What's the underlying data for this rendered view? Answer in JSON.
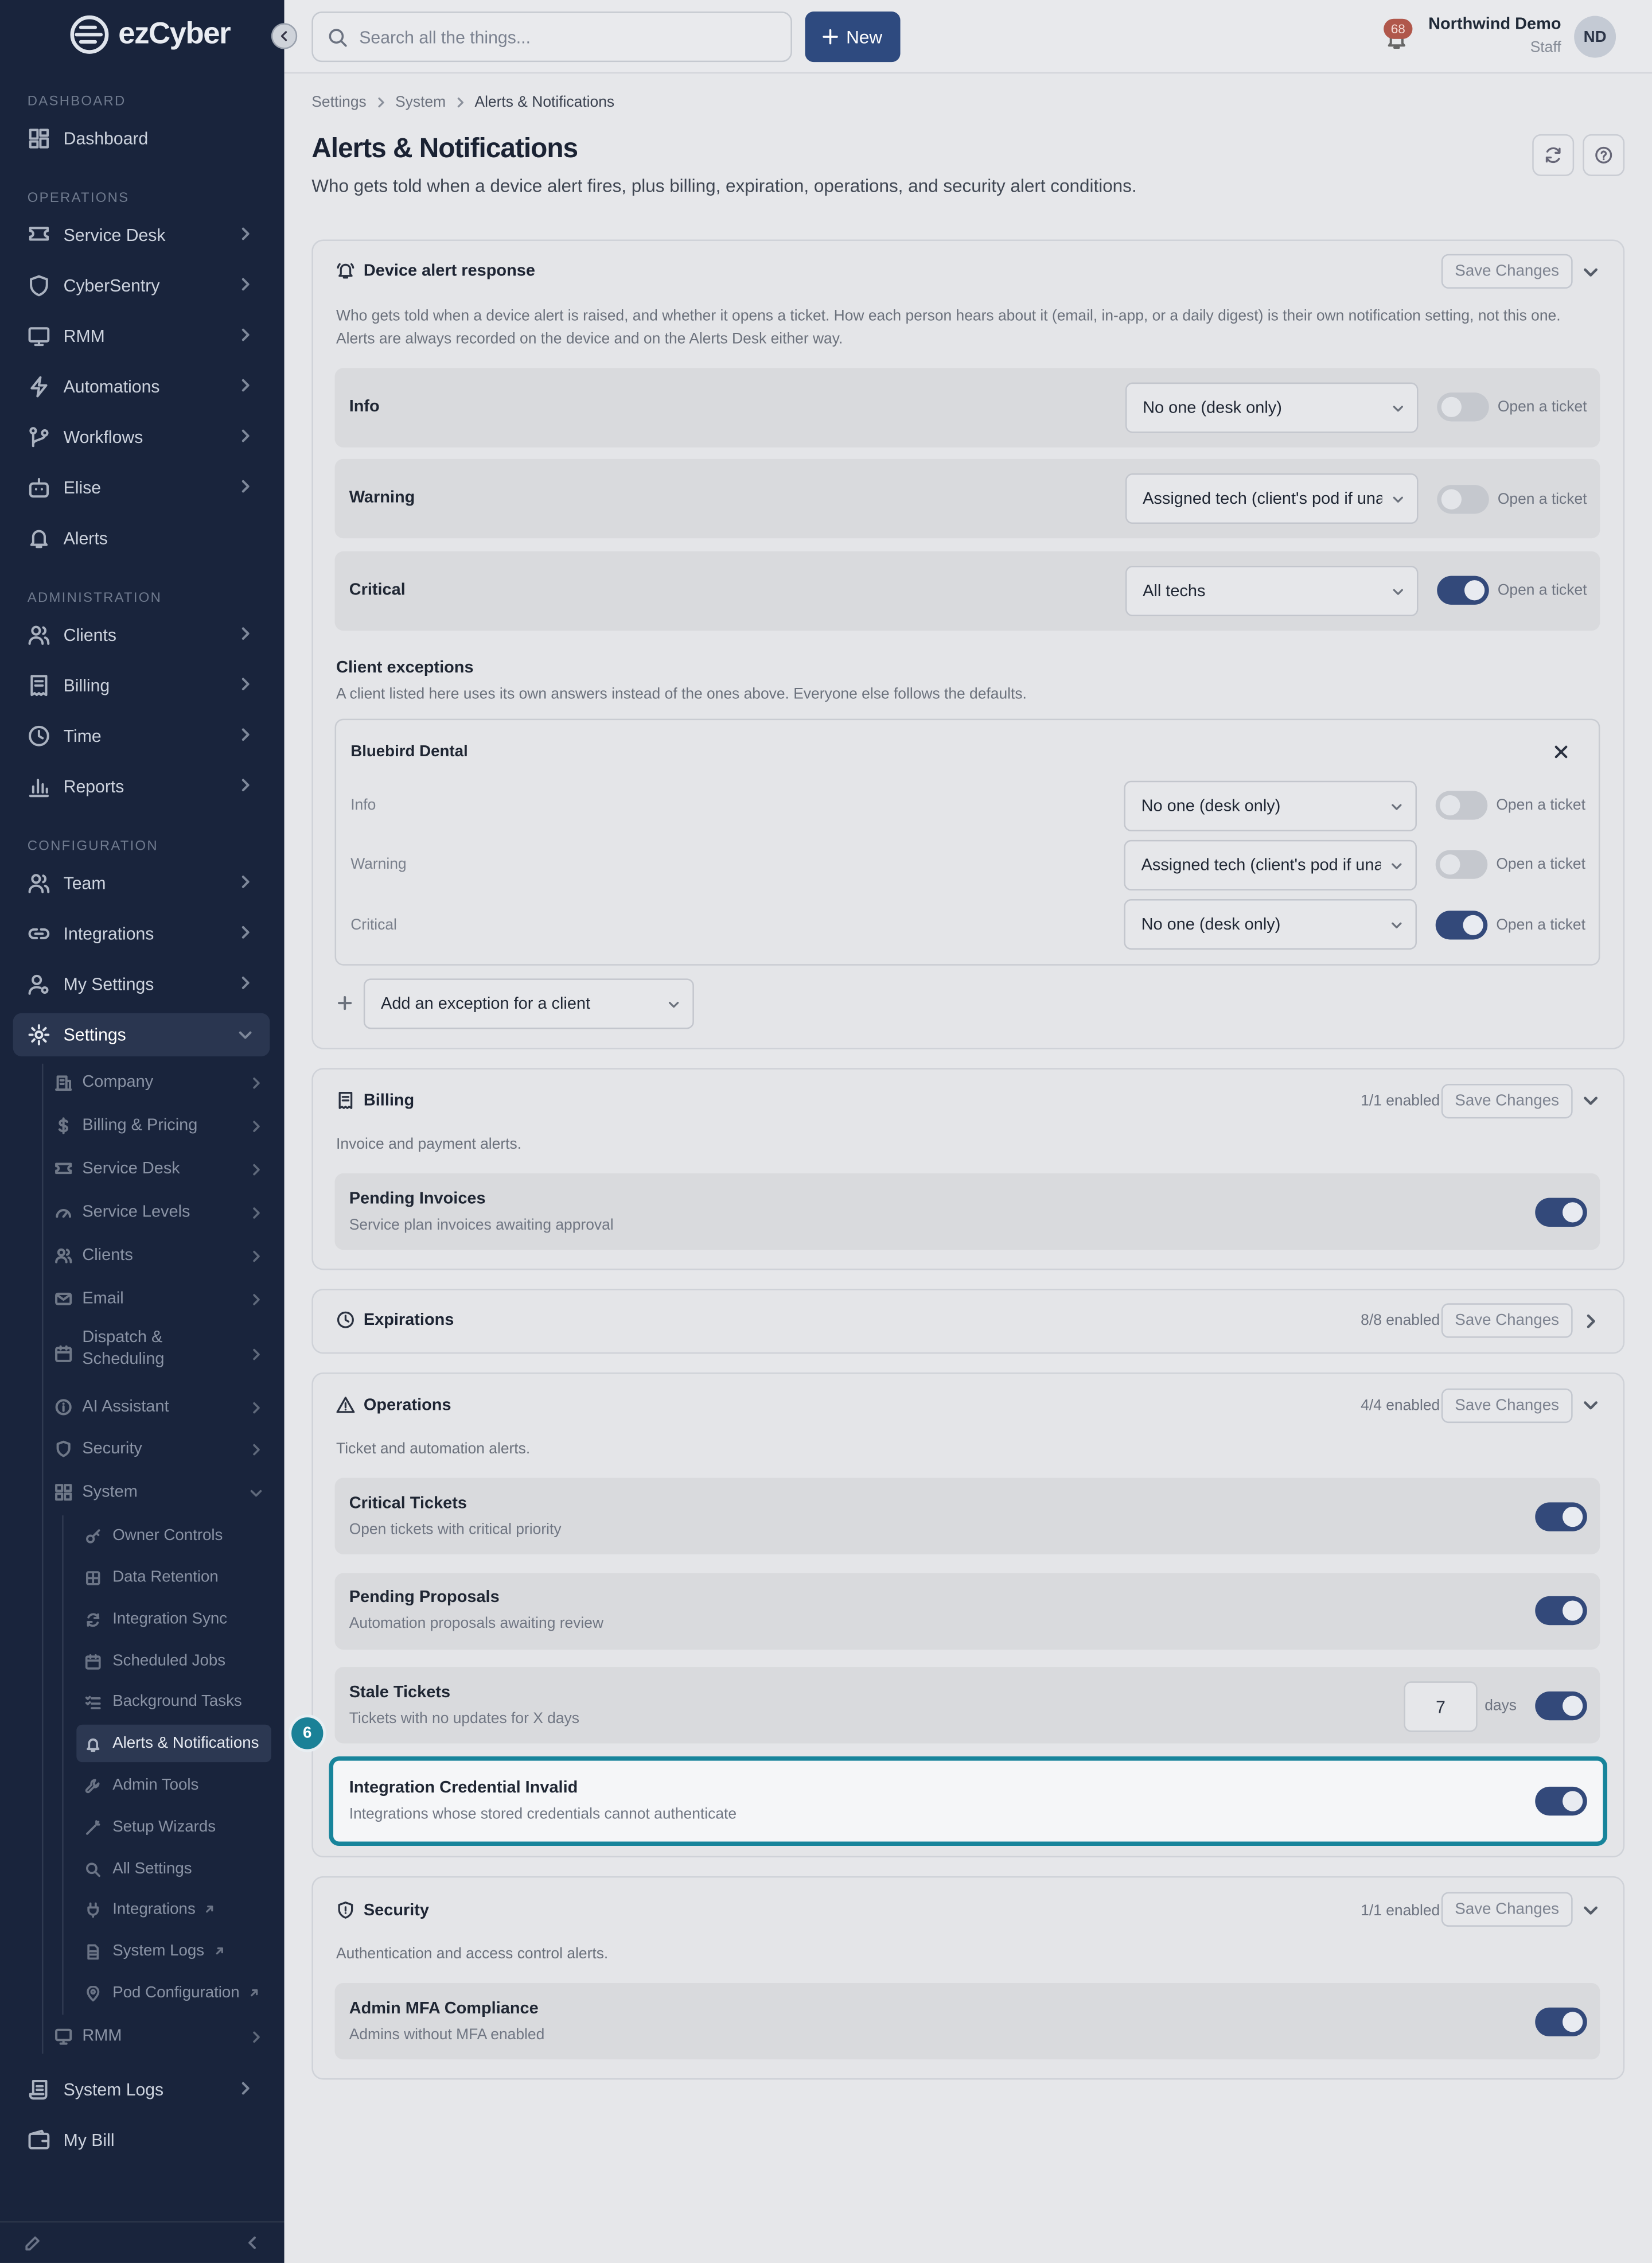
{
  "brand": {
    "wordmark": "ezCyber"
  },
  "topbar": {
    "search_placeholder": "Search all the things...",
    "new_label": "New",
    "notifications_count": "68",
    "user_name": "Northwind Demo",
    "user_role": "Staff",
    "avatar_initials": "ND"
  },
  "sidebar": {
    "sections": [
      "DASHBOARD",
      "OPERATIONS",
      "ADMINISTRATION",
      "CONFIGURATION"
    ],
    "items": {
      "dashboard": "Dashboard",
      "service_desk": "Service Desk",
      "cybersentry": "CyberSentry",
      "rmm": "RMM",
      "automations": "Automations",
      "workflows": "Workflows",
      "elise": "Elise",
      "alerts": "Alerts",
      "clients": "Clients",
      "billing": "Billing",
      "time": "Time",
      "reports": "Reports",
      "team": "Team",
      "integrations": "Integrations",
      "my_settings": "My Settings",
      "settings": "Settings",
      "system_logs": "System Logs",
      "my_bill": "My Bill"
    },
    "settings_sub": {
      "company": "Company",
      "billing_pricing": "Billing & Pricing",
      "service_desk": "Service Desk",
      "service_levels": "Service Levels",
      "clients": "Clients",
      "email": "Email",
      "dispatch_1": "Dispatch &",
      "dispatch_2": "Scheduling",
      "ai_assistant": "AI Assistant",
      "security": "Security",
      "system": "System",
      "rmm": "RMM"
    },
    "system_sub": {
      "owner_controls": "Owner Controls",
      "data_retention": "Data Retention",
      "integration_sync": "Integration Sync",
      "scheduled_jobs": "Scheduled Jobs",
      "background_tasks": "Background Tasks",
      "alerts_notifications": "Alerts & Notifications",
      "admin_tools": "Admin Tools",
      "setup_wizards": "Setup Wizards",
      "all_settings": "All Settings",
      "integrations": "Integrations",
      "system_logs": "System Logs",
      "pod_configuration": "Pod Configuration"
    }
  },
  "breadcrumb": [
    "Settings",
    "System",
    "Alerts & Notifications"
  ],
  "page": {
    "title": "Alerts & Notifications",
    "subtitle": "Who gets told when a device alert fires, plus billing, expiration, operations, and security alert conditions."
  },
  "save_label": "Save Changes",
  "device": {
    "title": "Device alert response",
    "desc1": "Who gets told when a device alert is raised, and whether it opens a ticket. How each person hears about it (email, in-app, or a daily digest) is their own notification setting, not this one.",
    "desc2": "Alerts are always recorded on the device and on the Alerts Desk either way.",
    "ticket_label": "Open a ticket",
    "rows": [
      {
        "label": "Info",
        "recipient": "No one (desk only)",
        "ticket": false
      },
      {
        "label": "Warning",
        "recipient": "Assigned tech (client's pod if unassigned)",
        "ticket": false
      },
      {
        "label": "Critical",
        "recipient": "All techs",
        "ticket": true
      }
    ],
    "exceptions_title": "Client exceptions",
    "exceptions_desc": "A client listed here uses its own answers instead of the ones above. Everyone else follows the defaults.",
    "exception": {
      "client": "Bluebird Dental",
      "rows": [
        {
          "label": "Info",
          "recipient": "No one (desk only)",
          "ticket": false
        },
        {
          "label": "Warning",
          "recipient": "Assigned tech (client's pod if unassigned)",
          "ticket": false
        },
        {
          "label": "Critical",
          "recipient": "No one (desk only)",
          "ticket": true
        }
      ]
    },
    "add_exception": "Add an exception for a client"
  },
  "billing": {
    "title": "Billing",
    "count": "1/1 enabled",
    "desc": "Invoice and payment alerts.",
    "items": [
      {
        "label": "Pending Invoices",
        "sub": "Service plan invoices awaiting approval",
        "on": true
      }
    ]
  },
  "expirations": {
    "title": "Expirations",
    "count": "8/8 enabled"
  },
  "operations": {
    "title": "Operations",
    "count": "4/4 enabled",
    "desc": "Ticket and automation alerts.",
    "items": [
      {
        "label": "Critical Tickets",
        "sub": "Open tickets with critical priority",
        "on": true
      },
      {
        "label": "Pending Proposals",
        "sub": "Automation proposals awaiting review",
        "on": true
      },
      {
        "label": "Stale Tickets",
        "sub": "Tickets with no updates for X days",
        "on": true,
        "days": "7",
        "days_label": "days"
      },
      {
        "label": "Integration Credential Invalid",
        "sub": "Integrations whose stored credentials cannot authenticate",
        "on": true
      }
    ]
  },
  "security": {
    "title": "Security",
    "count": "1/1 enabled",
    "desc": "Authentication and access control alerts.",
    "items": [
      {
        "label": "Admin MFA Compliance",
        "sub": "Admins without MFA enabled",
        "on": true
      }
    ]
  },
  "step_marker": "6",
  "colors": {
    "sidebar": "#19243c",
    "accent": "#2e4a7f",
    "highlight": "#17849b"
  }
}
